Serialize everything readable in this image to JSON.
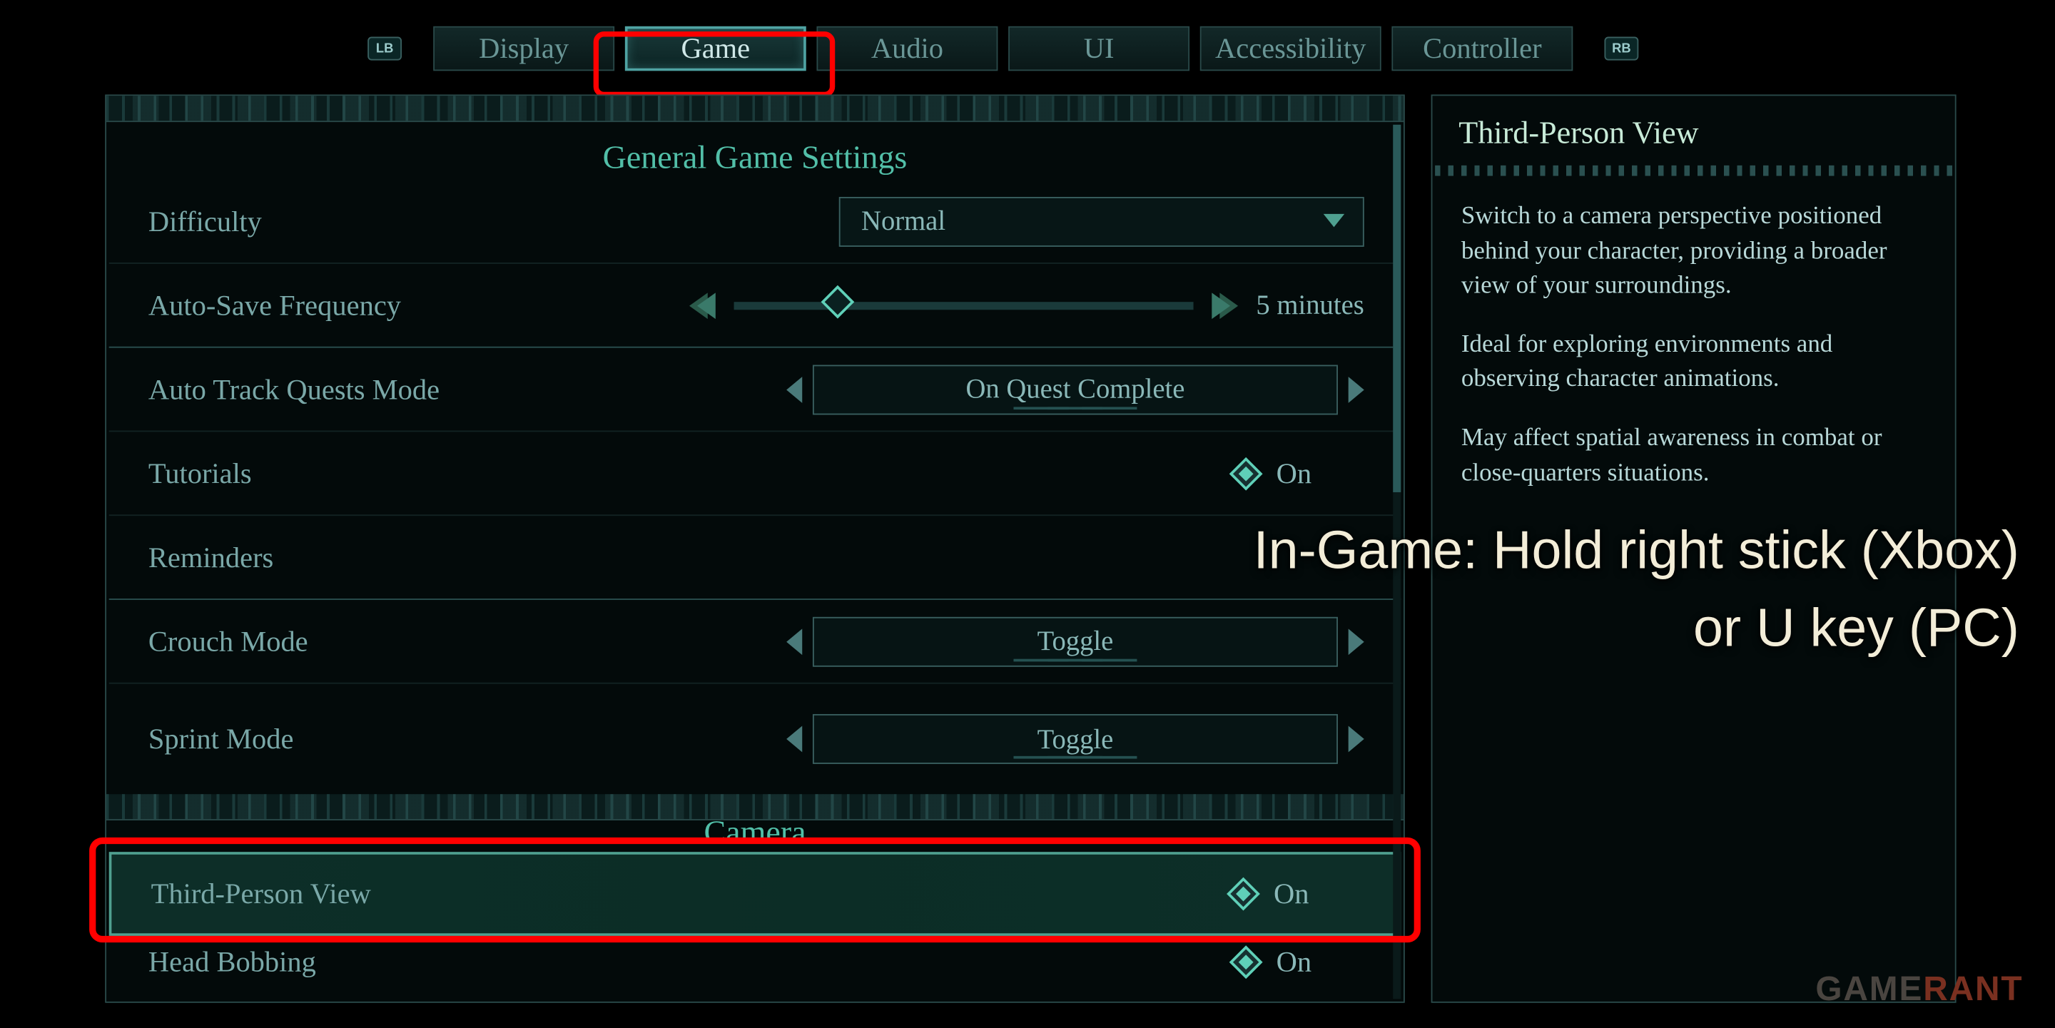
{
  "bumpers": {
    "left": "LB",
    "right": "RB"
  },
  "tabs": [
    "Display",
    "Game",
    "Audio",
    "UI",
    "Accessibility",
    "Controller"
  ],
  "active_tab": "Game",
  "sections": {
    "general": {
      "title": "General Game Settings",
      "difficulty": {
        "label": "Difficulty",
        "value": "Normal"
      },
      "autosave": {
        "label": "Auto-Save Frequency",
        "value": "5 minutes"
      },
      "autotrack": {
        "label": "Auto Track Quests Mode",
        "value": "On Quest Complete"
      },
      "tutorials": {
        "label": "Tutorials",
        "value": "On"
      },
      "reminders": {
        "label": "Reminders"
      },
      "crouch": {
        "label": "Crouch Mode",
        "value": "Toggle"
      },
      "sprint": {
        "label": "Sprint Mode",
        "value": "Toggle"
      }
    },
    "camera": {
      "title": "Camera",
      "tpv": {
        "label": "Third-Person View",
        "value": "On"
      },
      "headbob": {
        "label": "Head Bobbing",
        "value": "On"
      }
    }
  },
  "info": {
    "title": "Third-Person View",
    "p1": "Switch to a camera perspective positioned behind your character, providing a broader view of your surroundings.",
    "p2": "Ideal for exploring environments and observing character animations.",
    "p3": "May affect spatial awareness in combat or close-quarters situations."
  },
  "overlay": {
    "line1": "In-Game: Hold right stick (Xbox)",
    "line2": "or U key (PC)"
  },
  "watermark": {
    "a": "GAME",
    "b": "RANT"
  }
}
